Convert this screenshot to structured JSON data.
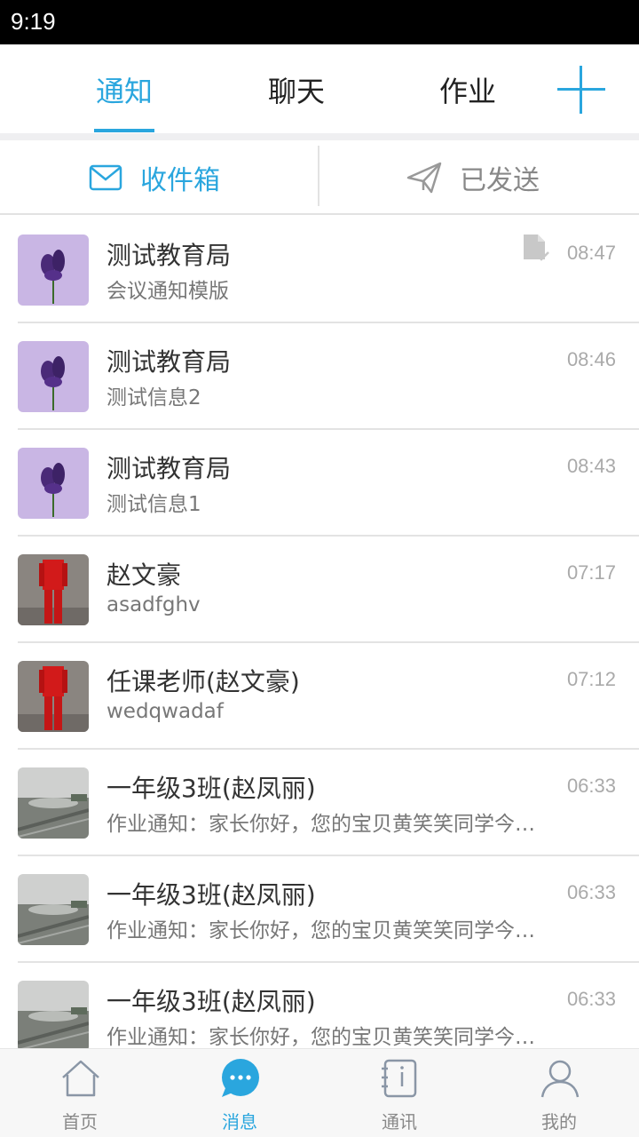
{
  "status_bar": {
    "time": "9:19"
  },
  "top_tabs": {
    "items": [
      {
        "label": "通知",
        "active": true
      },
      {
        "label": "聊天",
        "active": false
      },
      {
        "label": "作业",
        "active": false
      }
    ],
    "add_icon": "plus-icon"
  },
  "sub_tabs": {
    "inbox": {
      "label": "收件箱",
      "icon": "envelope-icon"
    },
    "sent": {
      "label": "已发送",
      "icon": "paper-plane-icon"
    }
  },
  "messages": [
    {
      "title": "测试教育局",
      "preview": "会议通知模版",
      "time": "08:47",
      "avatar": "lavender",
      "attachment_icon": "document-icon"
    },
    {
      "title": "测试教育局",
      "preview": "测试信息2",
      "time": "08:46",
      "avatar": "lavender"
    },
    {
      "title": "测试教育局",
      "preview": "测试信息1",
      "time": "08:43",
      "avatar": "lavender"
    },
    {
      "title": "赵文豪",
      "preview": "asadfghv",
      "time": "07:17",
      "avatar": "red-suit"
    },
    {
      "title": "任课老师(赵文豪)",
      "preview": "wedqwadaf",
      "time": "07:12",
      "avatar": "red-suit"
    },
    {
      "title": "一年级3班(赵凤丽)",
      "preview": "作业通知：家长你好，您的宝贝黄笑笑同学今天的作业",
      "time": "06:33",
      "avatar": "city"
    },
    {
      "title": "一年级3班(赵凤丽)",
      "preview": "作业通知：家长你好，您的宝贝黄笑笑同学今天的作业",
      "time": "06:33",
      "avatar": "city"
    },
    {
      "title": "一年级3班(赵凤丽)",
      "preview": "作业通知：家长你好，您的宝贝黄笑笑同学今天的作业",
      "time": "06:33",
      "avatar": "city"
    }
  ],
  "bottom_nav": {
    "items": [
      {
        "label": "首页",
        "icon": "home-icon",
        "active": false
      },
      {
        "label": "消息",
        "icon": "chat-bubble-icon",
        "active": true
      },
      {
        "label": "通讯",
        "icon": "contacts-book-icon",
        "active": false
      },
      {
        "label": "我的",
        "icon": "user-icon",
        "active": false
      }
    ]
  },
  "colors": {
    "accent": "#2aa6de",
    "inactive": "#888888"
  }
}
